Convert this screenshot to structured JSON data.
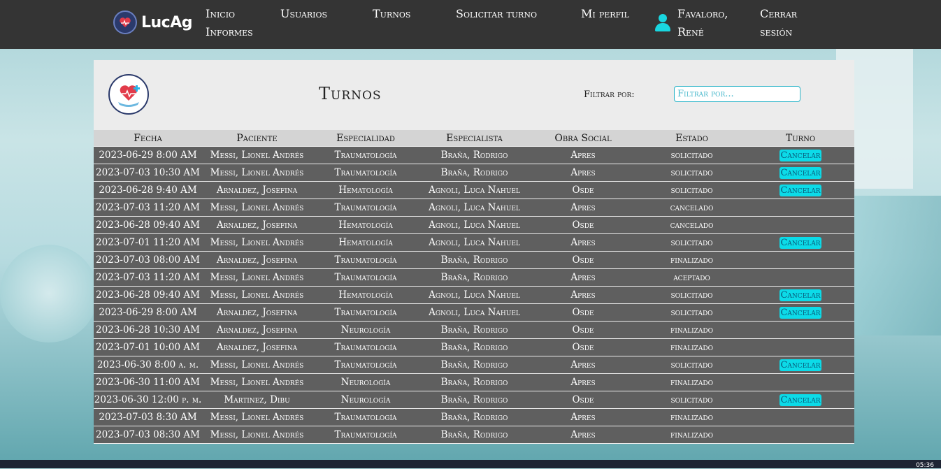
{
  "brand": {
    "name": "LucAg"
  },
  "nav": {
    "inicio": "Inicio",
    "informes": "Informes",
    "usuarios": "Usuarios",
    "turnos": "Turnos",
    "solicitar": "Solicitar turno",
    "perfil": "Mi perfil",
    "user_line1": "Favaloro,",
    "user_line2": "René",
    "logout_line1": "Cerrar",
    "logout_line2": "sesión"
  },
  "page": {
    "title": "Turnos",
    "filter_label": "Filtrar por:",
    "filter_placeholder": "Filtrar por...",
    "filter_value": ""
  },
  "table": {
    "headers": [
      "Fecha",
      "Paciente",
      "Especialidad",
      "Especialista",
      "Obra Social",
      "Estado",
      "Turno"
    ],
    "cancel_label": "Cancelar",
    "rows": [
      {
        "fecha": "2023-06-29 8:00 AM",
        "paciente": "Messi, Lionel Andrés",
        "especialidad": "Traumatología",
        "especialista": "Braña, Rodrigo",
        "obra": "Apres",
        "estado": "solicitado",
        "cancel": true
      },
      {
        "fecha": "2023-07-03 10:30 AM",
        "paciente": "Messi, Lionel Andrés",
        "especialidad": "Traumatología",
        "especialista": "Braña, Rodrigo",
        "obra": "Apres",
        "estado": "solicitado",
        "cancel": true
      },
      {
        "fecha": "2023-06-28 9:40 AM",
        "paciente": "Arnaldez, Josefina",
        "especialidad": "Hematología",
        "especialista": "Agnoli, Luca Nahuel",
        "obra": "Osde",
        "estado": "solicitado",
        "cancel": true
      },
      {
        "fecha": "2023-07-03 11:20 AM",
        "paciente": "Messi, Lionel Andrés",
        "especialidad": "Traumatología",
        "especialista": "Agnoli, Luca Nahuel",
        "obra": "Apres",
        "estado": "cancelado",
        "cancel": false
      },
      {
        "fecha": "2023-06-28 09:40 AM",
        "paciente": "Arnaldez, Josefina",
        "especialidad": "Hematología",
        "especialista": "Agnoli, Luca Nahuel",
        "obra": "Osde",
        "estado": "cancelado",
        "cancel": false
      },
      {
        "fecha": "2023-07-01 11:20 AM",
        "paciente": "Messi, Lionel Andrés",
        "especialidad": "Hematología",
        "especialista": "Agnoli, Luca Nahuel",
        "obra": "Apres",
        "estado": "solicitado",
        "cancel": true
      },
      {
        "fecha": "2023-07-03 08:00 AM",
        "paciente": "Arnaldez, Josefina",
        "especialidad": "Traumatología",
        "especialista": "Braña, Rodrigo",
        "obra": "Osde",
        "estado": "finalizado",
        "cancel": false
      },
      {
        "fecha": "2023-07-03 11:20 AM",
        "paciente": "Messi, Lionel Andrés",
        "especialidad": "Traumatología",
        "especialista": "Braña, Rodrigo",
        "obra": "Apres",
        "estado": "aceptado",
        "cancel": false
      },
      {
        "fecha": "2023-06-28 09:40 AM",
        "paciente": "Messi, Lionel Andrés",
        "especialidad": "Hematología",
        "especialista": "Agnoli, Luca Nahuel",
        "obra": "Apres",
        "estado": "solicitado",
        "cancel": true
      },
      {
        "fecha": "2023-06-29 8:00 AM",
        "paciente": "Arnaldez, Josefina",
        "especialidad": "Traumatología",
        "especialista": "Agnoli, Luca Nahuel",
        "obra": "Osde",
        "estado": "solicitado",
        "cancel": true
      },
      {
        "fecha": "2023-06-28 10:30 AM",
        "paciente": "Arnaldez, Josefina",
        "especialidad": "Neurología",
        "especialista": "Braña, Rodrigo",
        "obra": "Osde",
        "estado": "finalizado",
        "cancel": false
      },
      {
        "fecha": "2023-07-01 10:00 AM",
        "paciente": "Arnaldez, Josefina",
        "especialidad": "Traumatología",
        "especialista": "Braña, Rodrigo",
        "obra": "Osde",
        "estado": "finalizado",
        "cancel": false
      },
      {
        "fecha": "2023-06-30 8:00 a. m.",
        "paciente": "Messi, Lionel Andrés",
        "especialidad": "Traumatología",
        "especialista": "Braña, Rodrigo",
        "obra": "Apres",
        "estado": "solicitado",
        "cancel": true
      },
      {
        "fecha": "2023-06-30 11:00 AM",
        "paciente": "Messi, Lionel Andrés",
        "especialidad": "Neurología",
        "especialista": "Braña, Rodrigo",
        "obra": "Apres",
        "estado": "finalizado",
        "cancel": false
      },
      {
        "fecha": "2023-06-30 12:00 p. m.",
        "paciente": "Martinez, Dibu",
        "especialidad": "Neurología",
        "especialista": "Braña, Rodrigo",
        "obra": "Osde",
        "estado": "solicitado",
        "cancel": true
      },
      {
        "fecha": "2023-07-03 8:30 AM",
        "paciente": "Messi, Lionel Andrés",
        "especialidad": "Traumatología",
        "especialista": "Braña, Rodrigo",
        "obra": "Apres",
        "estado": "finalizado",
        "cancel": false
      },
      {
        "fecha": "2023-07-03 08:30 AM",
        "paciente": "Messi, Lionel Andrés",
        "especialidad": "Traumatología",
        "especialista": "Braña, Rodrigo",
        "obra": "Apres",
        "estado": "finalizado",
        "cancel": false
      }
    ]
  },
  "taskbar": {
    "time": "05:36"
  },
  "colors": {
    "navbar": "#343434",
    "accent": "#0cdbe8",
    "row": "#5f5f5f",
    "header": "#d4d4d4"
  }
}
